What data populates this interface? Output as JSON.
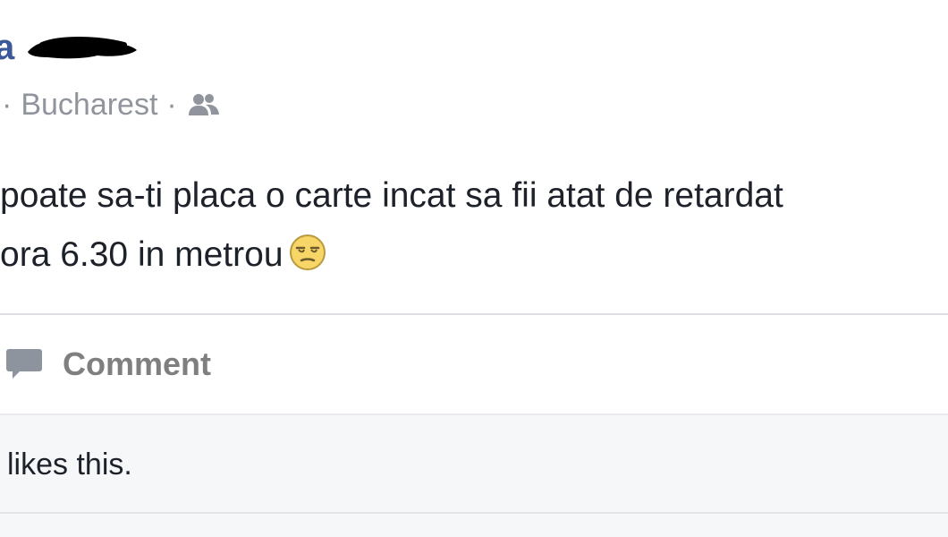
{
  "post": {
    "author_visible": "a",
    "location": "Bucharest",
    "meta_separator": "·",
    "audience_icon": "friends-icon",
    "text_line_1": "poate sa-ti placa o carte incat sa fii atat de retardat",
    "text_line_2": "ora 6.30 in metrou",
    "emoji_icon": "unamused-face-emoji"
  },
  "actions": {
    "comment_label": "Comment",
    "comment_icon": "speech-bubble-icon"
  },
  "likes": {
    "summary": "likes this."
  },
  "colors": {
    "author_link": "#3b5998",
    "meta_gray": "#90949c",
    "body_text": "#1d2129",
    "action_gray": "#7f7f7f",
    "likes_bg": "#f6f7f9"
  }
}
